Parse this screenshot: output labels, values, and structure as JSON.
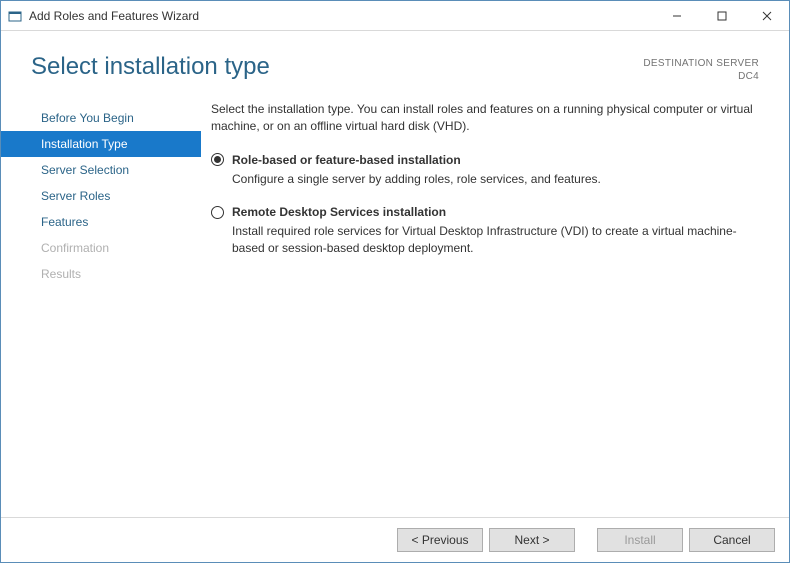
{
  "window": {
    "title": "Add Roles and Features Wizard"
  },
  "header": {
    "title": "Select installation type",
    "destination_label": "DESTINATION SERVER",
    "destination_value": "DC4"
  },
  "sidebar": {
    "items": [
      {
        "label": "Before You Begin",
        "state": "normal"
      },
      {
        "label": "Installation Type",
        "state": "active"
      },
      {
        "label": "Server Selection",
        "state": "normal"
      },
      {
        "label": "Server Roles",
        "state": "normal"
      },
      {
        "label": "Features",
        "state": "normal"
      },
      {
        "label": "Confirmation",
        "state": "disabled"
      },
      {
        "label": "Results",
        "state": "disabled"
      }
    ]
  },
  "main": {
    "intro": "Select the installation type. You can install roles and features on a running physical computer or virtual machine, or on an offline virtual hard disk (VHD).",
    "options": [
      {
        "title": "Role-based or feature-based installation",
        "desc": "Configure a single server by adding roles, role services, and features.",
        "selected": true
      },
      {
        "title": "Remote Desktop Services installation",
        "desc": "Install required role services for Virtual Desktop Infrastructure (VDI) to create a virtual machine-based or session-based desktop deployment.",
        "selected": false
      }
    ]
  },
  "footer": {
    "previous": "< Previous",
    "next": "Next >",
    "install": "Install",
    "cancel": "Cancel"
  }
}
